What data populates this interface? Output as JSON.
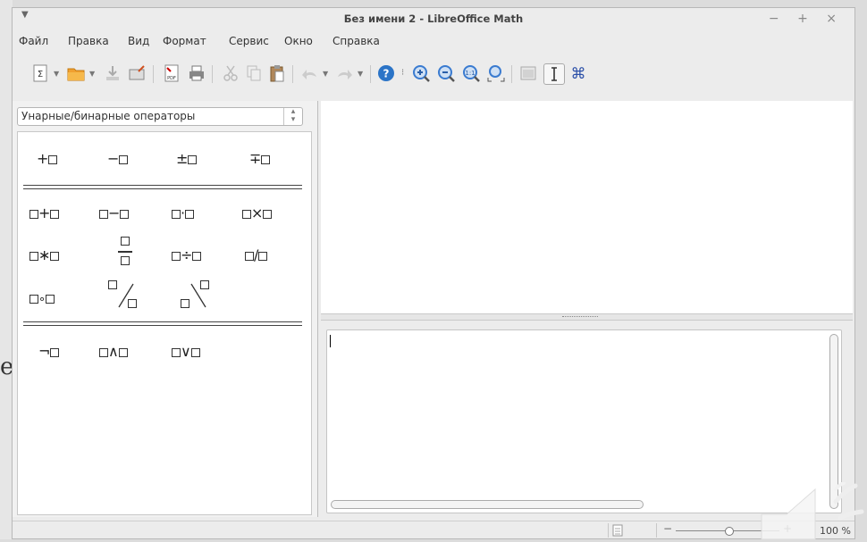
{
  "window": {
    "title": "Без имени 2 - LibreOffice Math",
    "controls": "− + ×"
  },
  "background_fragment": "er",
  "menu": [
    "Файл",
    "Правка",
    "Вид",
    "Формат",
    "Сервис",
    "Окно",
    "Справка"
  ],
  "elements_panel": {
    "category": "Унарные/бинарные операторы",
    "row1": [
      "+",
      "−",
      "±",
      "∓"
    ],
    "row2": [
      "+",
      "−",
      "·",
      "×"
    ],
    "row3": [
      "∗",
      "÷",
      "/"
    ],
    "row4": [
      "∘"
    ],
    "row5": [
      "¬",
      "∧",
      "∨"
    ]
  },
  "status": {
    "zoom": "100 %"
  },
  "colors": {
    "accent_blue": "#2b74c7",
    "title_text": "#444444"
  }
}
